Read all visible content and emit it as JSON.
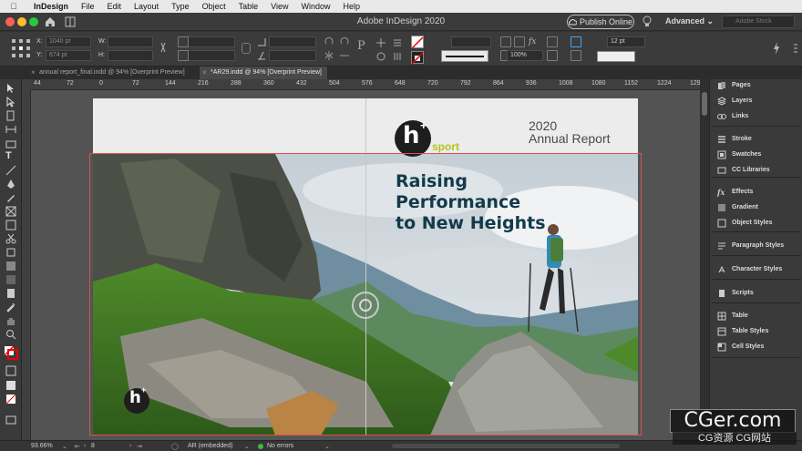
{
  "menubar": {
    "apple_icon": "apple-logo-icon",
    "items": [
      "InDesign",
      "File",
      "Edit",
      "Layout",
      "Type",
      "Object",
      "Table",
      "View",
      "Window",
      "Help"
    ]
  },
  "appbar": {
    "title": "Adobe InDesign 2020",
    "publish_label": "Publish Online",
    "workspace_label": "Advanced",
    "search_placeholder": "Adobe Stock",
    "colors": {
      "close": "#ff5f57",
      "minimize": "#febc2e",
      "zoom": "#28c840"
    }
  },
  "control": {
    "x_label": "X:",
    "x_value": "1040 pt",
    "y_label": "Y:",
    "y_value": "674 pt",
    "w_label": "W:",
    "h_label": "H:",
    "scale_value": "100%",
    "stroke_value": "12 pt"
  },
  "tabs": [
    {
      "label": "annual report_final.indd @ 94% [Overprint Preview]"
    },
    {
      "label": "*AR29.indd @ 94% [Overprint Preview]"
    }
  ],
  "ruler": {
    "ticks": [
      "44",
      "72",
      "0",
      "72",
      "144",
      "216",
      "288",
      "360",
      "432",
      "504",
      "576",
      "648",
      "720",
      "792",
      "864",
      "936",
      "1008",
      "1080",
      "1152",
      "1224",
      "1296"
    ]
  },
  "document": {
    "logo_letter": "h",
    "logo_plus": "+",
    "logo_sport": "sport",
    "year": "2020",
    "report_title": "Annual Report",
    "headline": [
      "Raising",
      "Performance",
      "to New Heights"
    ],
    "brand_green": "#b5c21b",
    "headline_color": "#123a4a"
  },
  "panels": [
    {
      "label": "Pages",
      "icon": "pages-icon"
    },
    {
      "label": "Layers",
      "icon": "layers-icon"
    },
    {
      "label": "Links",
      "icon": "links-icon"
    },
    {
      "label": "Stroke",
      "icon": "stroke-icon"
    },
    {
      "label": "Swatches",
      "icon": "swatches-icon"
    },
    {
      "label": "CC Libraries",
      "icon": "cc-libraries-icon"
    },
    {
      "label": "Effects",
      "icon": "effects-icon"
    },
    {
      "label": "Gradient",
      "icon": "gradient-icon"
    },
    {
      "label": "Object Styles",
      "icon": "object-styles-icon"
    },
    {
      "label": "Paragraph Styles",
      "icon": "paragraph-styles-icon"
    },
    {
      "label": "Character Styles",
      "icon": "character-styles-icon"
    },
    {
      "label": "Scripts",
      "icon": "scripts-icon"
    },
    {
      "label": "Table",
      "icon": "table-icon"
    },
    {
      "label": "Table Styles",
      "icon": "table-styles-icon"
    },
    {
      "label": "Cell Styles",
      "icon": "cell-styles-icon"
    }
  ],
  "status": {
    "zoom": "93.66%",
    "page": "8",
    "profile": "AR (embedded)",
    "errors": "No errors"
  },
  "watermark": {
    "main": "CGer.com",
    "sub": "CG资源 CG网站"
  }
}
